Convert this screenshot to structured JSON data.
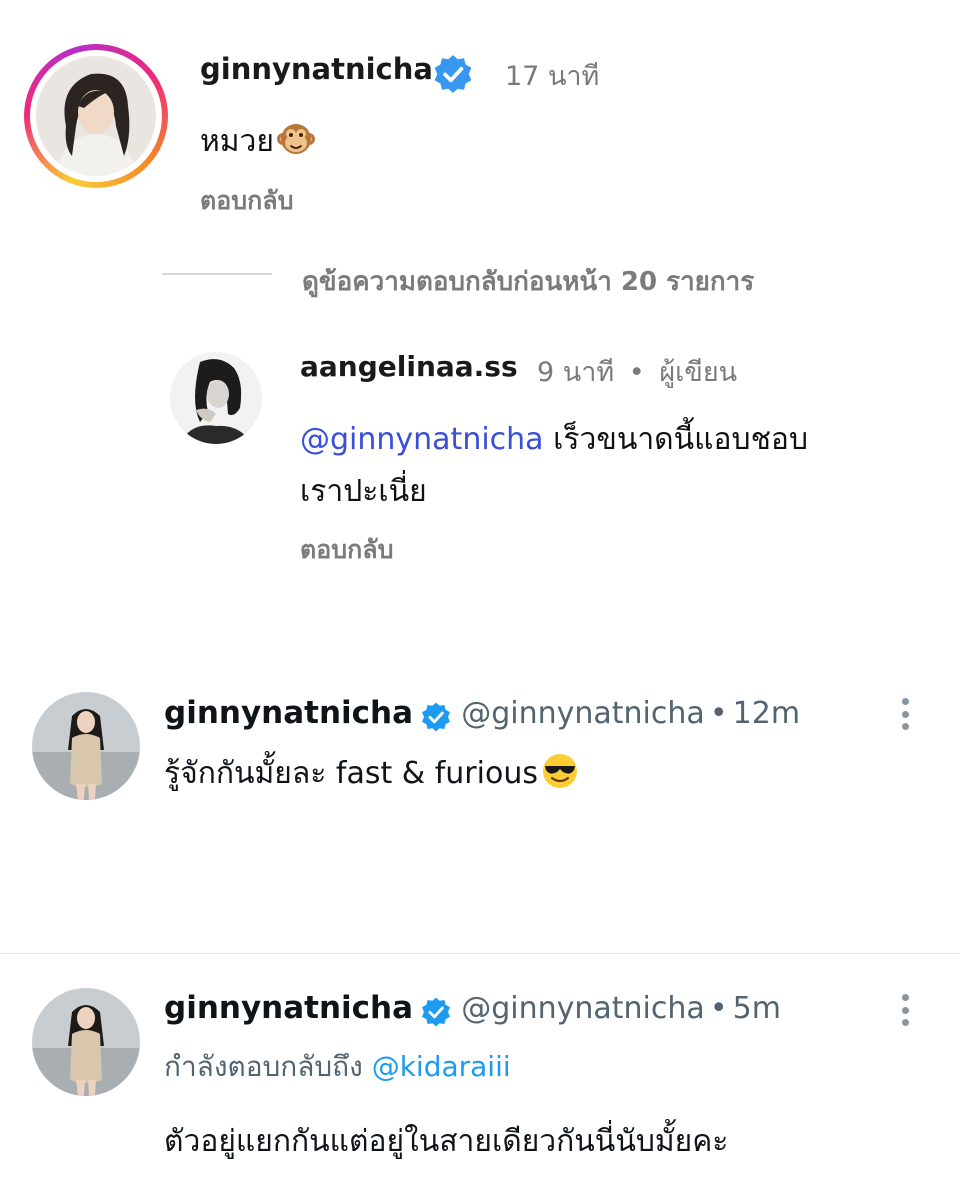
{
  "instagram": {
    "main_comment": {
      "username": "ginnynatnicha",
      "time": "17 นาที",
      "text": "หมวย",
      "emoji": "monkey-face",
      "reply_label": "ตอบกลับ"
    },
    "view_previous_replies": "ดูข้อความตอบกลับก่อนหน้า 20 รายการ",
    "reply": {
      "username": "aangelinaa.ss",
      "time": "9 นาที",
      "separator": "•",
      "author_badge": "ผู้เขียน",
      "mention": "@ginnynatnicha",
      "text_line1": "เร็วขนาดนี้แอบชอบ",
      "text_line2": "เราปะเนี่ย",
      "reply_label": "ตอบกลับ"
    }
  },
  "twitter": {
    "tweets": [
      {
        "name": "ginnynatnicha",
        "handle": "@ginnynatnicha",
        "dot": "•",
        "time": "12m",
        "text": "รู้จักกันมั้ยละ fast & furious",
        "emoji": "smiling-face-with-sunglasses"
      },
      {
        "name": "ginnynatnicha",
        "handle": "@ginnynatnicha",
        "dot": "•",
        "time": "5m",
        "replying_to_label": "กำลังตอบกลับถึง",
        "replying_to_handle": "@kidaraiii",
        "text": "ตัวอยู่แยกกันแต่อยู่ในสายเดียวกันนี่นับมั้ยคะ"
      }
    ]
  },
  "colors": {
    "ig_verified": "#3897f0",
    "tw_verified": "#1d9bf0",
    "mention": "#3a4fd8",
    "tw_link": "#1d9bf0",
    "muted": "#7a7a7a"
  }
}
